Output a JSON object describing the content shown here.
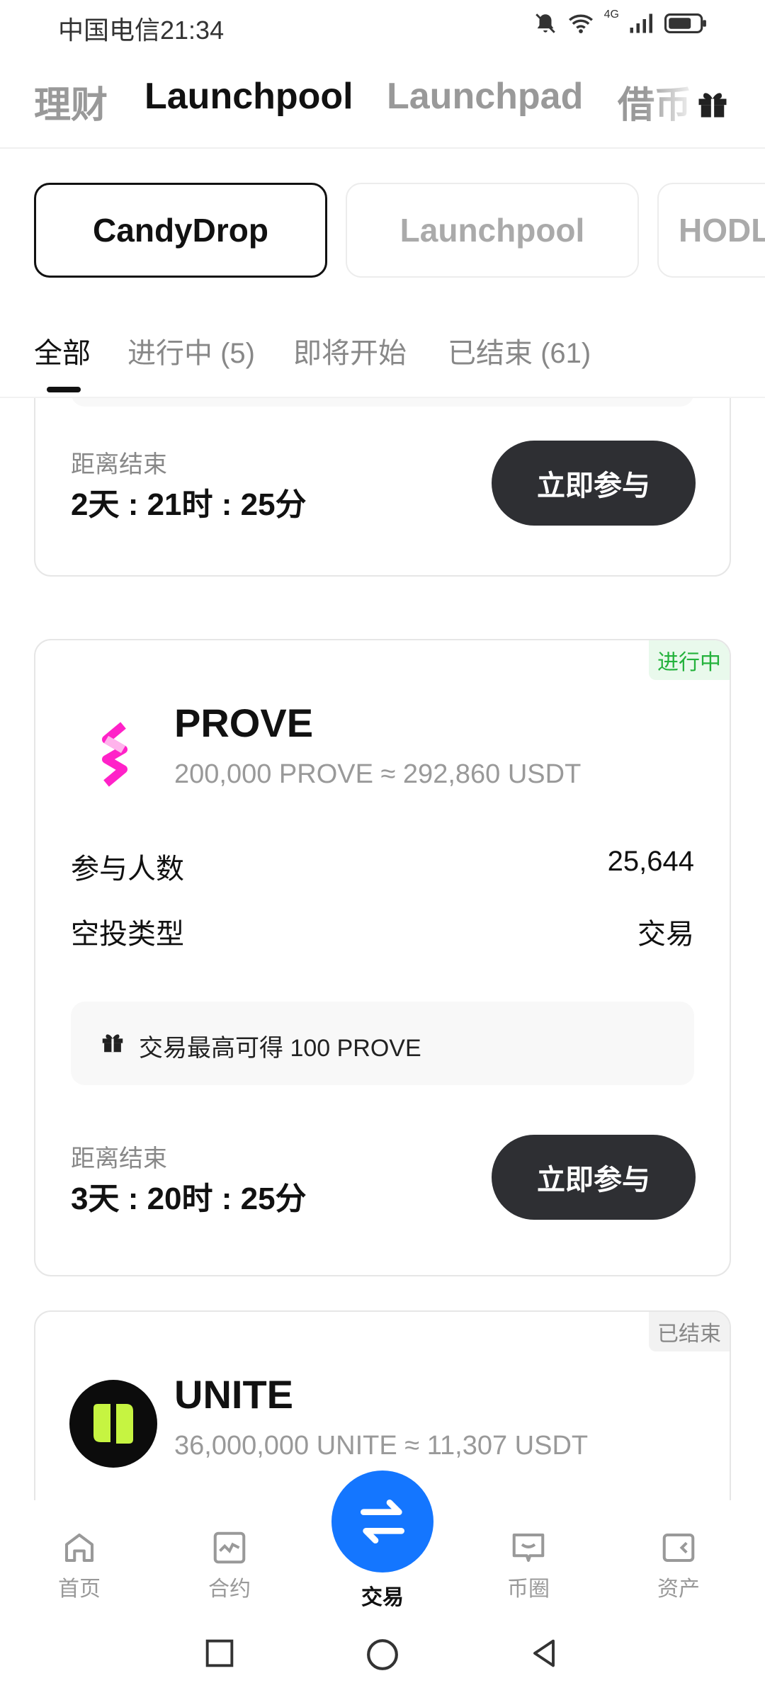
{
  "status_bar": {
    "carrier_time": "中国电信21:34",
    "network": "4G"
  },
  "top_nav": {
    "tabs": [
      {
        "label": "理财",
        "active": false
      },
      {
        "label": "Launchpool",
        "active": true
      },
      {
        "label": "Launchpad",
        "active": false
      },
      {
        "label": "借币",
        "active": false
      }
    ],
    "gift_icon": "gift-icon"
  },
  "pill_tabs": [
    {
      "label": "CandyDrop",
      "active": true
    },
    {
      "label": "Launchpool",
      "active": false
    },
    {
      "label": "HODL",
      "active": false
    }
  ],
  "filters": [
    {
      "label": "全部",
      "active": true
    },
    {
      "label": "进行中 (5)",
      "active": false
    },
    {
      "label": "即将开始",
      "active": false
    },
    {
      "label": "已结束 (61)",
      "active": false
    }
  ],
  "cards": [
    {
      "end_label": "距离结束",
      "end_time": "2天 : 21时 : 25分",
      "button": "立即参与"
    },
    {
      "status": "进行中",
      "title": "PROVE",
      "subtitle": "200,000 PROVE ≈ 292,860 USDT",
      "rows": [
        {
          "label": "参与人数",
          "value": "25,644"
        },
        {
          "label": "空投类型",
          "value": "交易"
        }
      ],
      "tip": "交易最高可得 100 PROVE",
      "end_label": "距离结束",
      "end_time": "3天 : 20时 : 25分",
      "button": "立即参与",
      "logo_color": "#ff22c8"
    },
    {
      "status": "已结束",
      "title": "UNITE",
      "subtitle": "36,000,000 UNITE ≈ 11,307 USDT",
      "logo_color": "#c6f441"
    }
  ],
  "bottom_nav": [
    {
      "label": "首页",
      "icon": "home-icon"
    },
    {
      "label": "合约",
      "icon": "chart-icon"
    },
    {
      "label": "交易",
      "icon": "swap-icon"
    },
    {
      "label": "币圈",
      "icon": "chat-icon"
    },
    {
      "label": "资产",
      "icon": "wallet-icon"
    }
  ]
}
